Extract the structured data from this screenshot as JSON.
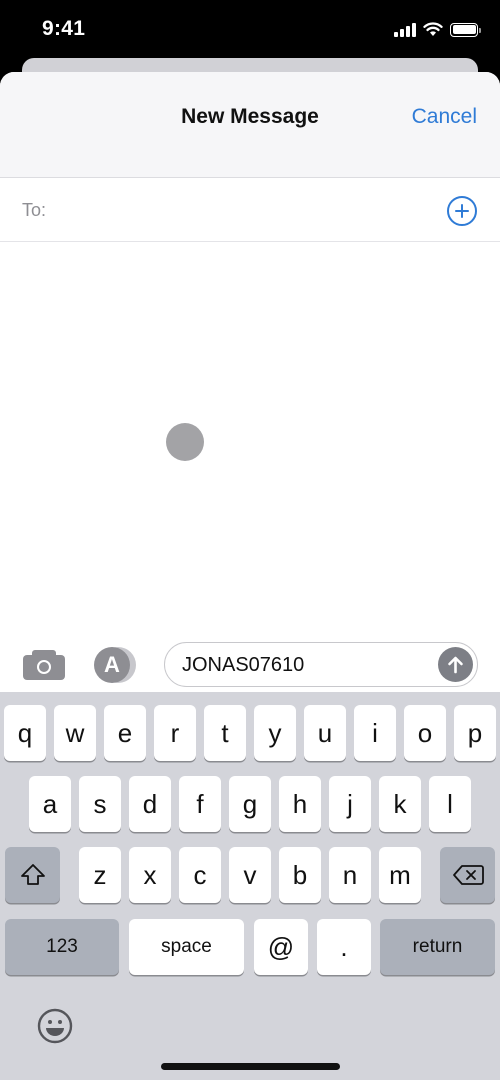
{
  "status_bar": {
    "time": "9:41",
    "icons": [
      "cellular-signal-icon",
      "wifi-icon",
      "battery-icon"
    ]
  },
  "header": {
    "title": "New Message",
    "cancel_label": "Cancel"
  },
  "recipient": {
    "label": "To:",
    "value": "",
    "add_icon": "plus-circle-icon"
  },
  "compose": {
    "camera_icon": "camera-icon",
    "apps_icon": "app-store-icon",
    "apps_glyph": "A",
    "message_value": "JONAS07610",
    "send_icon": "arrow-up-icon"
  },
  "keyboard": {
    "row1": [
      "q",
      "w",
      "e",
      "r",
      "t",
      "y",
      "u",
      "i",
      "o",
      "p"
    ],
    "row2": [
      "a",
      "s",
      "d",
      "f",
      "g",
      "h",
      "j",
      "k",
      "l"
    ],
    "row3": [
      "z",
      "x",
      "c",
      "v",
      "b",
      "n",
      "m"
    ],
    "shift_icon": "shift-icon",
    "delete_icon": "delete-backward-icon",
    "numbers_label": "123",
    "space_label": "space",
    "at_label": "@",
    "period_label": ".",
    "return_label": "return",
    "emoji_icon": "emoji-icon"
  },
  "colors": {
    "accent": "#2f7bd6",
    "keyboard_bg": "#d3d4da",
    "special_key": "#abb0ba"
  }
}
